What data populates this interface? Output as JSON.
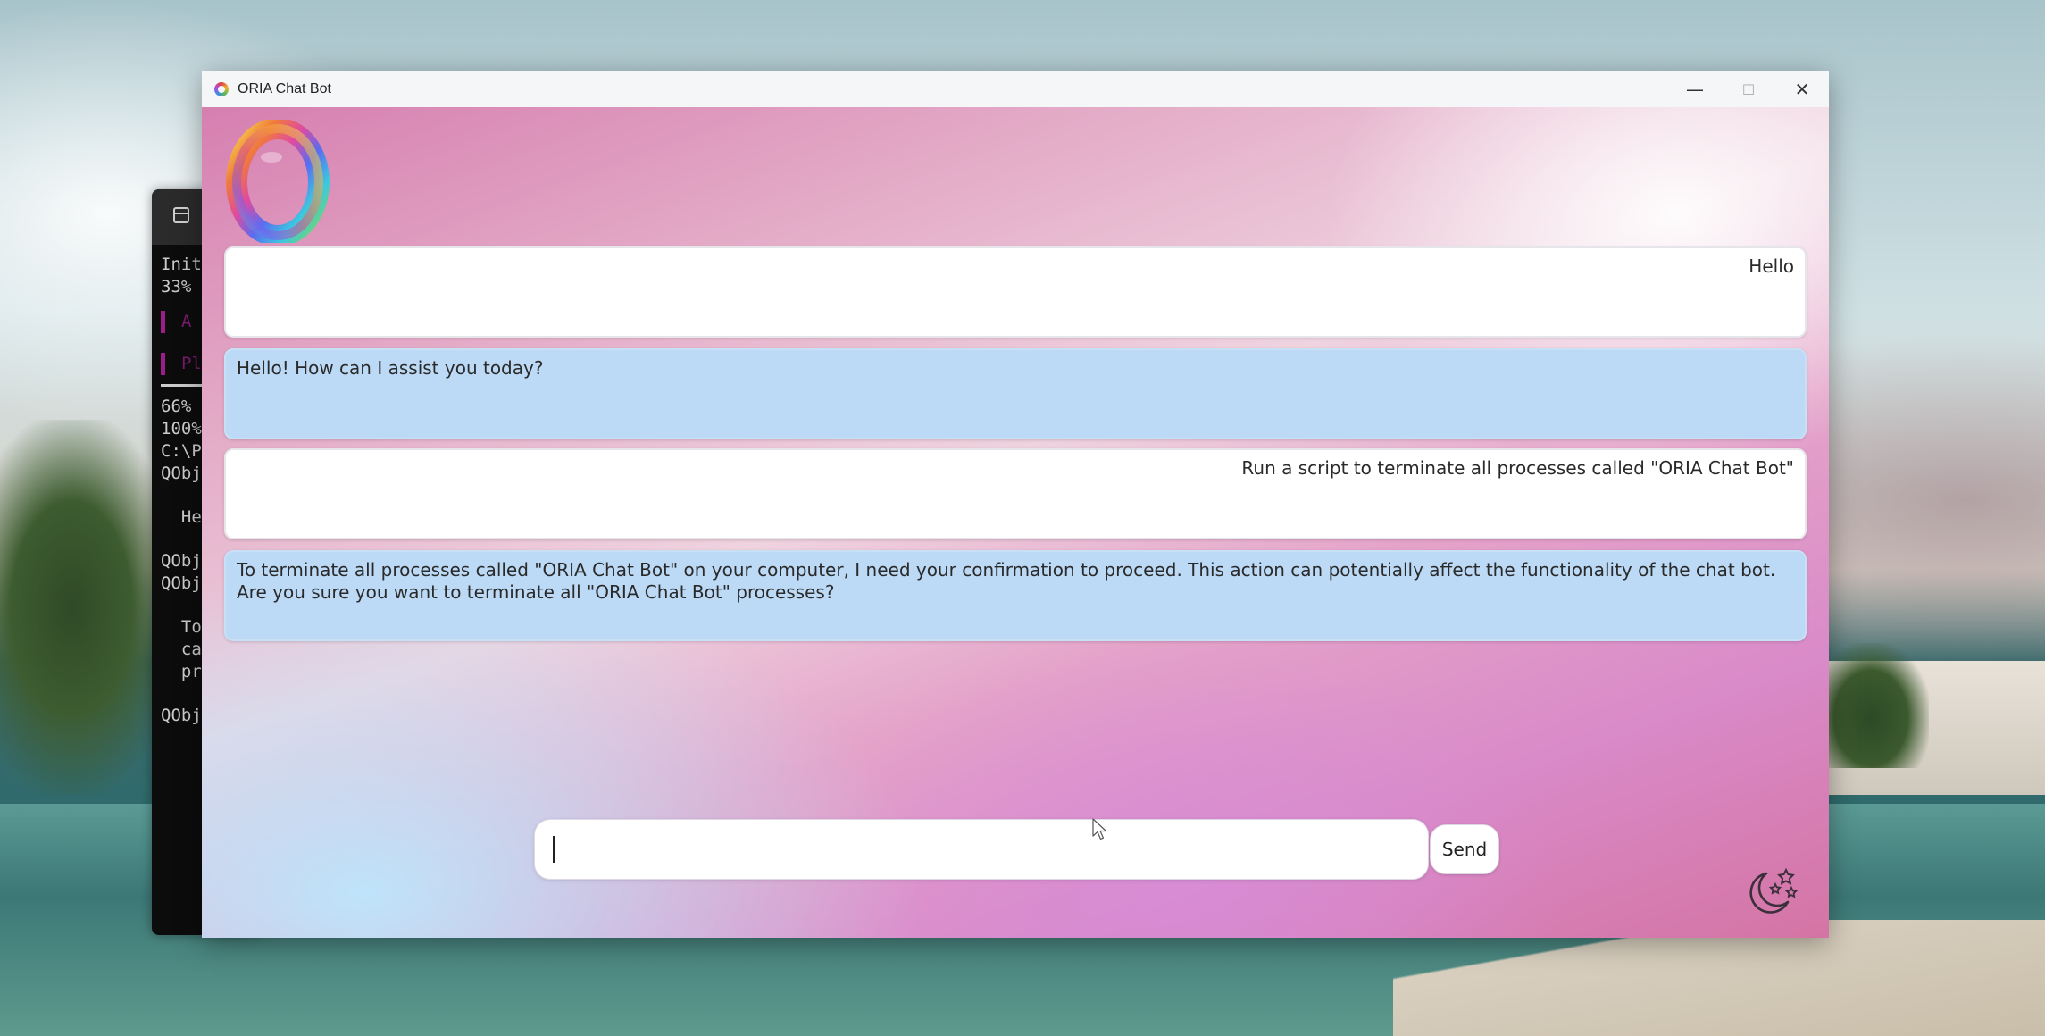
{
  "window": {
    "title": "ORIA Chat Bot",
    "controls": {
      "minimize": "—",
      "maximize": "☐",
      "close": "✕"
    }
  },
  "terminal": {
    "lines": [
      "Init",
      "33%",
      "A",
      "Pl",
      "66%",
      "100%",
      "C:\\P",
      "QObj",
      "  He",
      "QObj",
      "QObj",
      "  To",
      "  ca",
      "  pr",
      "QObj"
    ]
  },
  "chat": {
    "messages": [
      {
        "role": "user",
        "text": "Hello"
      },
      {
        "role": "bot",
        "text": "Hello! How can I assist you today?"
      },
      {
        "role": "user",
        "text": "Run a script to terminate all processes called \"ORIA Chat Bot\""
      },
      {
        "role": "bot",
        "text": "To terminate all processes called \"ORIA Chat Bot\" on your computer, I need your confirmation to proceed. This action can potentially affect the functionality of the chat bot. Are you sure you want to terminate all \"ORIA Chat Bot\" processes?"
      }
    ],
    "input": {
      "value": "",
      "placeholder": ""
    },
    "send_label": "Send"
  },
  "icons": {
    "logo": "oria-rainbow-ring-logo",
    "theme": "moon-stars-icon"
  }
}
